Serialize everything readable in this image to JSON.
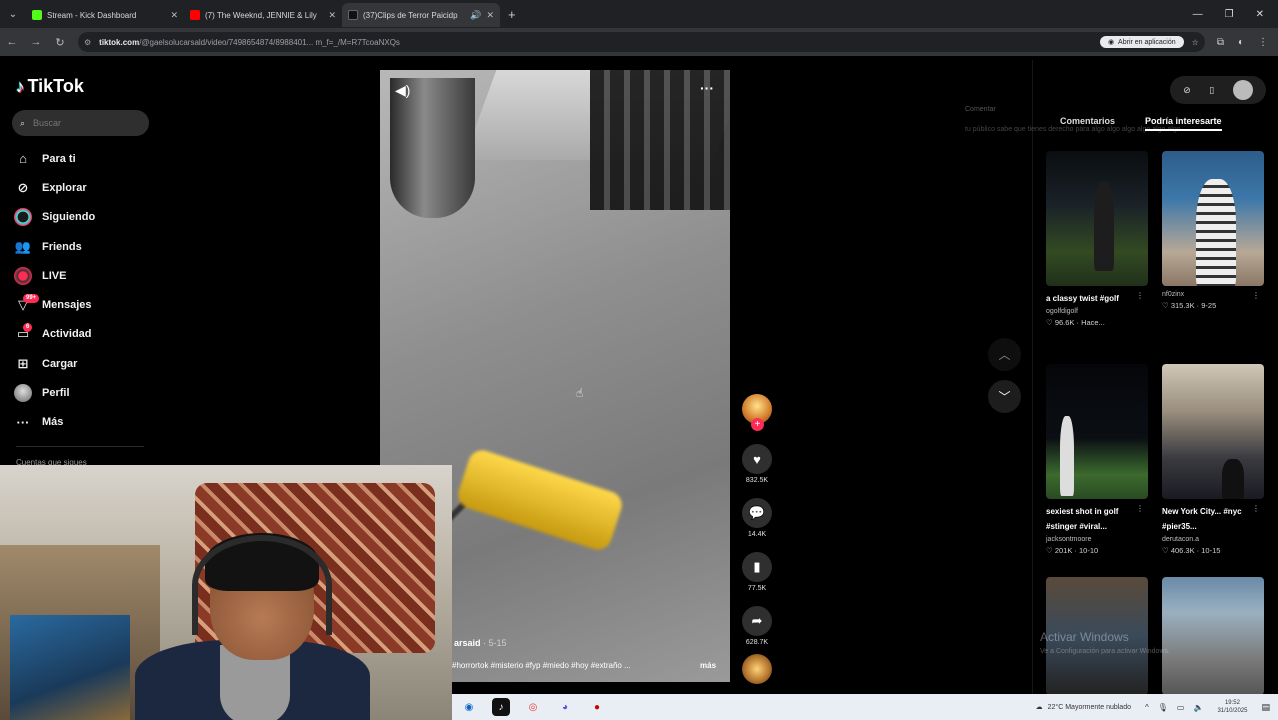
{
  "browser": {
    "tabs": [
      {
        "label": "Stream - Kick Dashboard",
        "fav_color": "#53fc18",
        "active": false
      },
      {
        "label": "(7) The Weeknd, JENNIE & Lily",
        "fav_color": "#ff0000",
        "active": false
      },
      {
        "label": "(37)Clips de Terror Paicidp",
        "fav_color": "#111111",
        "active": true
      }
    ],
    "url_host": "tiktok.com",
    "url_path": "/@gaelsolucarsald/video/7498654874/8988401... m_f=_/M=R7TcoaNXQs",
    "open_app_label": "Abrir en aplicación"
  },
  "tiktok": {
    "logo": "TikTok",
    "search_placeholder": "Buscar",
    "nav": [
      {
        "label": "Para ti",
        "icon": "home-icon"
      },
      {
        "label": "Explorar",
        "icon": "compass-icon"
      },
      {
        "label": "Siguiendo",
        "icon": "following-icon"
      },
      {
        "label": "Friends",
        "icon": "friends-icon"
      },
      {
        "label": "LIVE",
        "icon": "live-icon"
      },
      {
        "label": "Mensajes",
        "icon": "messages-icon",
        "badge": "99+"
      },
      {
        "label": "Actividad",
        "icon": "activity-icon",
        "badge": "6"
      },
      {
        "label": "Cargar",
        "icon": "upload-icon"
      },
      {
        "label": "Perfil",
        "icon": "profile-icon"
      },
      {
        "label": "Más",
        "icon": "more-icon"
      }
    ],
    "following_label": "Cuentas que sigues"
  },
  "video": {
    "author": "arsaid",
    "date": "· 5-15",
    "caption": "#horrortok #misterio #fyp #miedo #hoy #extraño ...",
    "more": "más",
    "actions": {
      "likes": "832.5K",
      "comments": "14.4K",
      "saves": "77.5K",
      "shares": "628.7K"
    }
  },
  "right_panel": {
    "ghost_title": "Comentar",
    "ghost_text": "tu público sabe que tienes derecho para algo algo algo algo algo algo",
    "tabs": [
      "Comentarios",
      "Podría interesarte"
    ],
    "active_tab": 1,
    "cards": [
      {
        "title": "a classy twist #golf",
        "user": "ogolfdigolf",
        "stats": "96.6K · Hace...",
        "thumb": "t1"
      },
      {
        "title": "",
        "user": "nf0zinx",
        "stats": "315.3K · 9-25",
        "thumb": "t2"
      },
      {
        "title": "sexiest shot in golf #stinger #viral...",
        "user": "jacksontmoore",
        "stats": "201K · 10-10",
        "thumb": "t3"
      },
      {
        "title": "New York City... #nyc #pier35...",
        "user": "derutacon.a",
        "stats": "406.3K · 10-15",
        "thumb": "t4"
      },
      {
        "title": "",
        "user": "",
        "stats": "",
        "thumb": "t5"
      },
      {
        "title": "",
        "user": "",
        "stats": "",
        "thumb": "t6"
      }
    ],
    "watermark": "Activar Windows",
    "watermark_sub": "Ve a Configuración para activar Windows."
  },
  "taskbar": {
    "weather": "22°C  Mayormente nublado",
    "time": "19:52",
    "date": "31/10/2025"
  }
}
